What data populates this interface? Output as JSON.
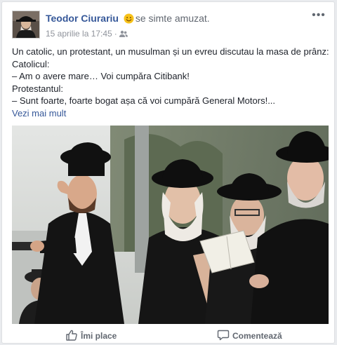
{
  "post": {
    "author": "Teodor Ciurariu",
    "feeling": "se simte amuzat.",
    "date": "15 aprilie la 17:45",
    "more_label": "•••",
    "lines": [
      "Un catolic, un protestant, un musulman și un evreu discutau la masa de prânz:",
      "Catolicul:",
      "– Am o avere mare… Voi cumpăra Citibank!",
      "Protestantul:",
      "– Sunt foarte, foarte bogat așa că voi cumpără General Motors!..."
    ],
    "see_more": "Vezi mai mult"
  },
  "actions": {
    "like": "Îmi place",
    "comment": "Comentează"
  },
  "icons": {
    "emoji": "smiley-icon",
    "audience": "friends-icon",
    "like": "thumbs-up-icon",
    "comment": "speech-bubble-icon"
  },
  "colors": {
    "link": "#365899",
    "text": "#1d2129",
    "meta": "#90949c",
    "emoji": "#f7c21a"
  }
}
